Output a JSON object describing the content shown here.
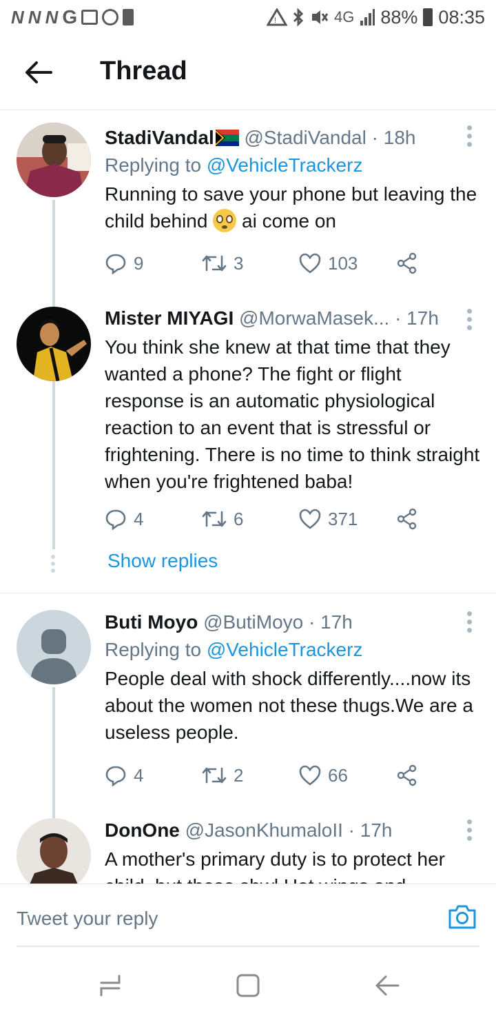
{
  "status_bar": {
    "left_icons": [
      "N",
      "N",
      "N",
      "G"
    ],
    "network": "4G",
    "battery": "88%",
    "time": "08:35"
  },
  "header": {
    "title": "Thread"
  },
  "tweets": [
    {
      "name": "StadiVandal",
      "handle": "@StadiVandal",
      "time": "18h",
      "replying_label": "Replying to",
      "replying_to": "@VehicleTrackerz",
      "text_1": "Running to save your phone but leaving the child behind",
      "text_2": "ai come on",
      "replies": "9",
      "retweets": "3",
      "likes": "103"
    },
    {
      "name": "Mister MIYAGI",
      "handle": "@MorwaMasek...",
      "time": "17h",
      "text": "You think she knew at that time that they wanted a phone? The fight or flight response is an automatic physiological reaction to an event that is stressful or frightening.  There is no time to think straight when you're frightened baba!",
      "replies": "4",
      "retweets": "6",
      "likes": "371",
      "show_replies": "Show replies"
    },
    {
      "name": "Buti Moyo",
      "handle": "@ButiMoyo",
      "time": "17h",
      "replying_label": "Replying to",
      "replying_to": "@VehicleTrackerz",
      "text": "People deal with shock differently....now its about the women not these thugs.We are a useless people.",
      "replies": "4",
      "retweets": "2",
      "likes": "66"
    },
    {
      "name": "DonOne",
      "handle": "@JasonKhumaloII",
      "time": "17h",
      "text": "A mother's primary duty is to protect her child, but these sbwl Hot wings and"
    }
  ],
  "composer": {
    "placeholder": "Tweet your reply"
  },
  "colors": {
    "link": "#1b95e0",
    "secondary": "#657786",
    "text": "#14171a",
    "divider": "#e1e8ed"
  },
  "icons": [
    "back-arrow-icon",
    "more-vertical-icon",
    "reply-icon",
    "retweet-icon",
    "like-icon",
    "share-icon",
    "camera-icon",
    "recents-icon",
    "home-icon",
    "back-nav-icon"
  ]
}
